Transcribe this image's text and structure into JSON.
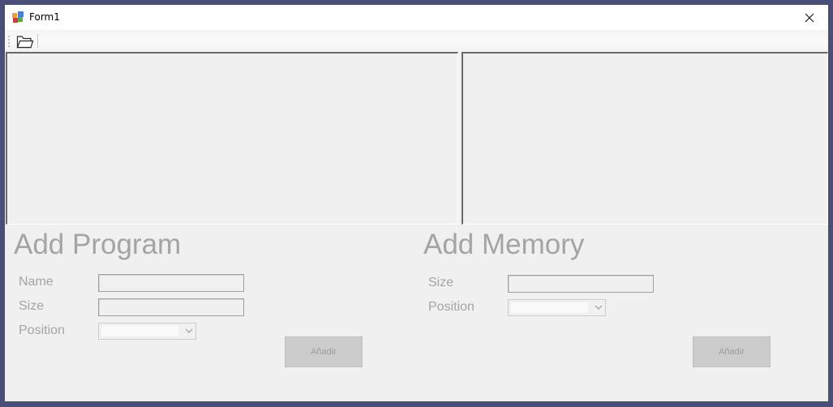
{
  "window": {
    "title": "Form1",
    "app_icon": "windows-form-icon",
    "close_icon": "close-icon"
  },
  "toolbar": {
    "items": [
      {
        "name": "open-folder-button",
        "icon": "open-folder-icon"
      }
    ]
  },
  "add_program": {
    "heading": "Add Program",
    "name_label": "Name",
    "name_value": "",
    "size_label": "Size",
    "size_value": "",
    "position_label": "Position",
    "position_value": "",
    "submit_label": "Añadir"
  },
  "add_memory": {
    "heading": "Add Memory",
    "size_label": "Size",
    "size_value": "",
    "position_label": "Position",
    "position_value": "",
    "submit_label": "Añadir"
  },
  "colors": {
    "disabled_text": "#a4a4a4",
    "window_bg": "#f0f0f0",
    "desktop_bg": "#4a4f7a"
  }
}
